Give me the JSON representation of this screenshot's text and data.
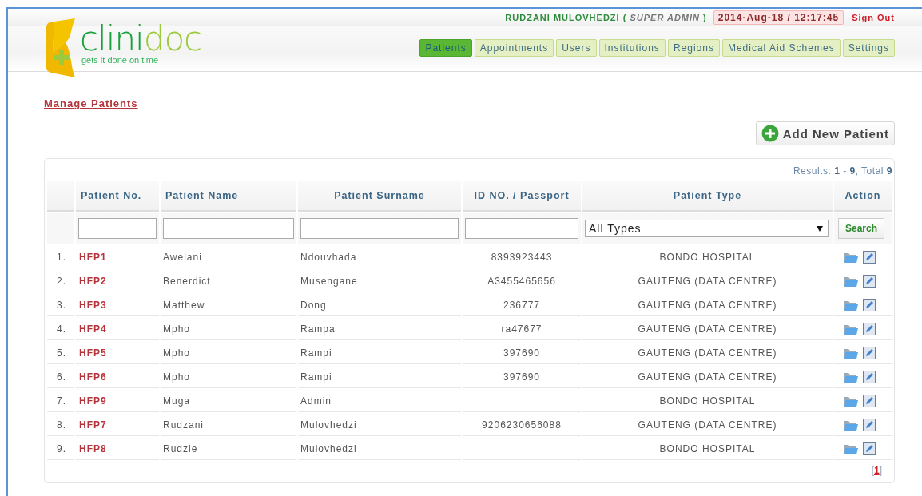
{
  "user_bar": {
    "user_name": "RUDZANI MULOVHEDZI",
    "role_open": "(",
    "role": "SUPER ADMIN",
    "role_close": ")",
    "datetime": "2014-Aug-18 / 12:17:45",
    "sign_out": "Sign Out"
  },
  "logo": {
    "name_dark": "clini",
    "name_light": "doc",
    "tagline": "gets it done on time"
  },
  "nav": [
    {
      "label": "Patients",
      "selected": true
    },
    {
      "label": "Appointments",
      "selected": false
    },
    {
      "label": "Users",
      "selected": false
    },
    {
      "label": "Institutions",
      "selected": false
    },
    {
      "label": "Regions",
      "selected": false
    },
    {
      "label": "Medical Aid Schemes",
      "selected": false
    },
    {
      "label": "Settings",
      "selected": false
    }
  ],
  "page_title": "Manage Patients",
  "add_button": "Add New Patient",
  "results": "Results: **1** - **9**, Total **9**",
  "table": {
    "columns": [
      "Patient No.",
      "Patient Name",
      "Patient Surname",
      "ID NO. / Passport",
      "Patient Type",
      "Action"
    ],
    "filter_type": "All Types",
    "search_button": "Search",
    "rows": [
      {
        "index": "1.",
        "number": "HFP1",
        "name": "Awelani",
        "surname": "Ndouvhada",
        "id": "8393923443",
        "type": "BONDO HOSPITAL"
      },
      {
        "index": "2.",
        "number": "HFP2",
        "name": "Benerdict",
        "surname": "Musengane",
        "id": "A3455465656",
        "type": "GAUTENG (DATA CENTRE)"
      },
      {
        "index": "3.",
        "number": "HFP3",
        "name": "Matthew",
        "surname": "Dong",
        "id": "236777",
        "type": "GAUTENG (DATA CENTRE)"
      },
      {
        "index": "4.",
        "number": "HFP4",
        "name": "Mpho",
        "surname": "Rampa",
        "id": "ra47677",
        "type": "GAUTENG (DATA CENTRE)"
      },
      {
        "index": "5.",
        "number": "HFP5",
        "name": "Mpho",
        "surname": "Rampi",
        "id": "397690",
        "type": "GAUTENG (DATA CENTRE)"
      },
      {
        "index": "6.",
        "number": "HFP6",
        "name": "Mpho",
        "surname": "Rampi",
        "id": "397690",
        "type": "GAUTENG (DATA CENTRE)"
      },
      {
        "index": "7.",
        "number": "HFP9",
        "name": "Muga",
        "surname": "Admin",
        "id": "",
        "type": "BONDO HOSPITAL"
      },
      {
        "index": "8.",
        "number": "HFP7",
        "name": "Rudzani",
        "surname": "Mulovhedzi",
        "id": "9206230656088",
        "type": "GAUTENG (DATA CENTRE)"
      },
      {
        "index": "9.",
        "number": "HFP8",
        "name": "Rudzie",
        "surname": "Mulovhedzi",
        "id": "",
        "type": "BONDO HOSPITAL"
      }
    ]
  },
  "pagination": {
    "open": "[",
    "pages": [
      {
        "label": "1",
        "selected": true
      }
    ],
    "close": "]"
  }
}
